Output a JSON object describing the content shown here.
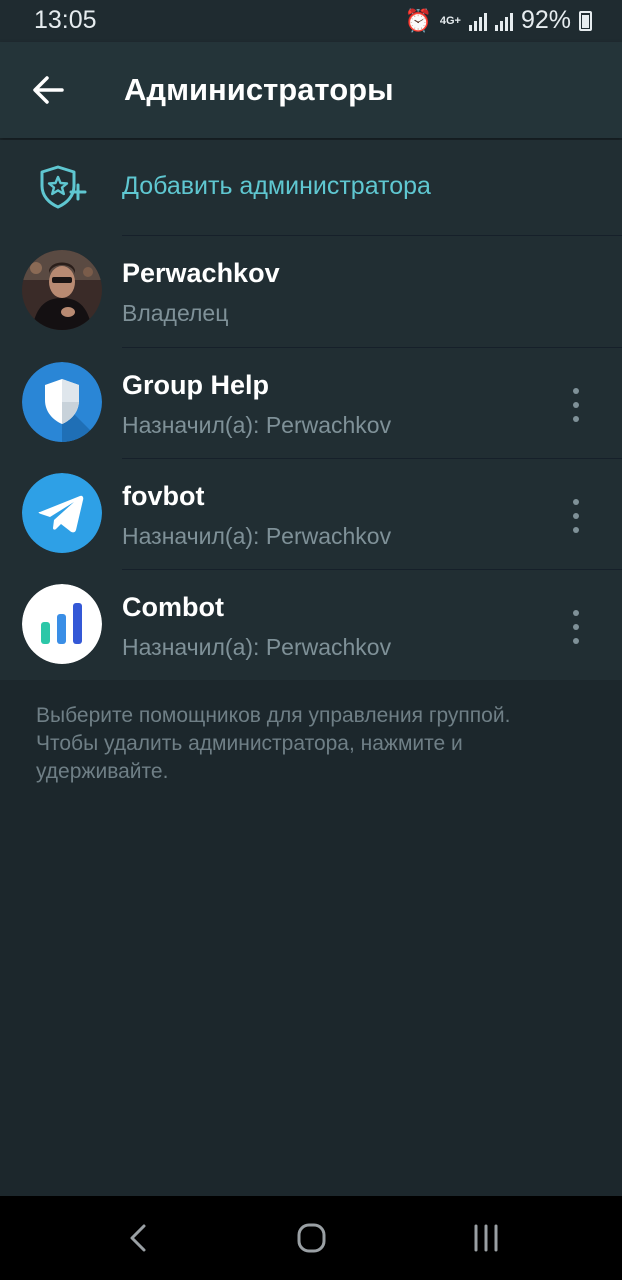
{
  "status_bar": {
    "time": "13:05",
    "network": "4G+",
    "battery": "92%"
  },
  "header": {
    "title": "Администраторы",
    "back_icon": "arrow-left-icon"
  },
  "add_admin": {
    "label": "Добавить администратора",
    "icon": "shield-star-plus-icon"
  },
  "admins": [
    {
      "name": "Perwachkov",
      "subtitle": "Владелец",
      "has_menu": false
    },
    {
      "name": "Group Help",
      "subtitle": "Назначил(а): Perwachkov",
      "has_menu": true
    },
    {
      "name": "fovbot",
      "subtitle": "Назначил(а): Perwachkov",
      "has_menu": true
    },
    {
      "name": "Combot",
      "subtitle": "Назначил(а): Perwachkov",
      "has_menu": true
    }
  ],
  "info": "Выберите помощников для управления группой. Чтобы удалить администратора, нажмите и удерживайте.",
  "colors": {
    "accent": "#5fc7d1",
    "background": "#1c272c",
    "list_background": "#212e33",
    "header_background": "#243439"
  }
}
